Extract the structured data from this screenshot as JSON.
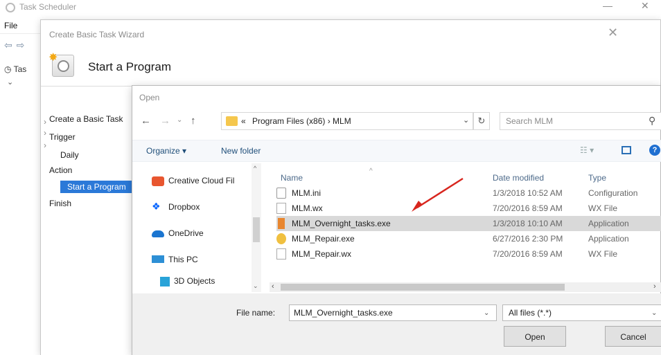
{
  "background": {
    "title": "Task Scheduler",
    "menu_file": "File",
    "tree_label": "Tas"
  },
  "wizard": {
    "title": "Create Basic Task Wizard",
    "heading": "Start a Program",
    "steps": [
      "Create a Basic Task",
      "Trigger",
      "Daily",
      "Action",
      "Start a Program",
      "Finish"
    ]
  },
  "open_dialog": {
    "title": "Open",
    "address_prefix": "«",
    "address": "Program Files (x86)  ›  MLM",
    "search_placeholder": "Search MLM",
    "toolbar": {
      "organize": "Organize ▾",
      "new_folder": "New folder"
    },
    "nav_items": [
      {
        "label": "Creative Cloud Fil",
        "icon": "creative-cloud-icon",
        "color": "#e8562f"
      },
      {
        "label": "Dropbox",
        "icon": "dropbox-icon",
        "color": "#0061fe"
      },
      {
        "label": "OneDrive",
        "icon": "onedrive-icon",
        "color": "#1b75d0"
      },
      {
        "label": "This PC",
        "icon": "this-pc-icon",
        "color": "#2d8fd5"
      },
      {
        "label": "3D Objects",
        "icon": "3d-objects-icon",
        "color": "#29a3d8"
      }
    ],
    "columns": {
      "name": "Name",
      "date": "Date modified",
      "type": "Type"
    },
    "files": [
      {
        "name": "MLM.ini",
        "date": "1/3/2018 10:52 AM",
        "type": "Configuration",
        "icon": "ini-file-icon"
      },
      {
        "name": "MLM.wx",
        "date": "7/20/2016 8:59 AM",
        "type": "WX File",
        "icon": "file-icon"
      },
      {
        "name": "MLM_Overnight_tasks.exe",
        "date": "1/3/2018 10:10 AM",
        "type": "Application",
        "icon": "exe-icon",
        "selected": true
      },
      {
        "name": "MLM_Repair.exe",
        "date": "6/27/2016 2:30 PM",
        "type": "Application",
        "icon": "repair-exe-icon"
      },
      {
        "name": "MLM_Repair.wx",
        "date": "7/20/2016 8:59 AM",
        "type": "WX File",
        "icon": "file-icon"
      }
    ],
    "file_name_label": "File name:",
    "file_name_value": "MLM_Overnight_tasks.exe",
    "file_type": "All files (*.*)",
    "open_label": "Open",
    "cancel_label": "Cancel",
    "accent_color": "#2b79d8"
  }
}
